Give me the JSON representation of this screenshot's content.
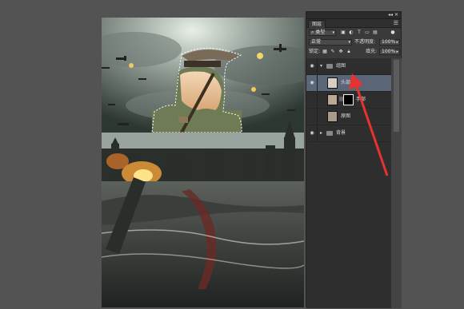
{
  "panel": {
    "tab_label": "图层",
    "controls": "◂◂ ✕",
    "kind_filter": "类型",
    "blend_mode": "正常",
    "opacity_label": "不透明度:",
    "opacity_value": "100%",
    "lock_label": "锁定:",
    "fill_label": "填充:",
    "fill_value": "100%",
    "filter_icons": [
      "image-icon",
      "circle-icon",
      "text-icon",
      "shape-icon",
      "smart-object-icon"
    ],
    "lock_icons": [
      "lock-pixels-icon",
      "lock-brush-icon",
      "lock-move-icon",
      "lock-all-icon"
    ]
  },
  "layers": [
    {
      "name": "组图",
      "type": "group",
      "visible": true,
      "expanded": true
    },
    {
      "name": "头部",
      "type": "layer",
      "visible": true,
      "selected": true
    },
    {
      "name": "手部",
      "type": "masked",
      "visible": false
    },
    {
      "name": "原图",
      "type": "layer",
      "visible": false
    },
    {
      "name": "背景",
      "type": "group",
      "visible": true,
      "expanded": false
    }
  ],
  "colors": {
    "workspace": "#535353",
    "panel": "#3a3a3a",
    "selected_layer": "#5a6678",
    "annotation_arrow": "#e8322f"
  }
}
